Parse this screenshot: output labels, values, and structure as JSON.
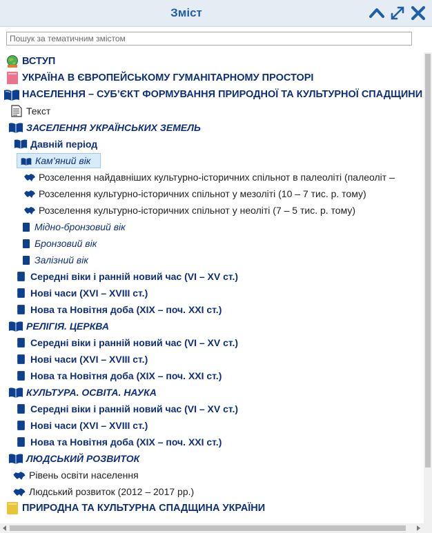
{
  "header": {
    "title": "Зміст",
    "icons": [
      "chevron-up-icon",
      "expand-icon",
      "close-icon"
    ],
    "accent": "#1f5fa8"
  },
  "search": {
    "placeholder": "Пошук за тематичним змістом",
    "value": ""
  },
  "tree": {
    "r0": "ВСТУП",
    "r1": "УКРАЇНА В ЄВРОПЕЙСЬКОМУ ГУМАНІТАРНОМУ ПРОСТОРІ",
    "r2": "НАСЕЛЕННЯ – СУБ’ЄКТ ФОРМУВАННЯ ПРИРОДНОЇ ТА КУЛЬТУРНОЇ СПАДЩИНИ",
    "r3": "Текст",
    "r4": "ЗАСЕЛЕННЯ УКРАЇНСЬКИХ ЗЕМЕЛЬ",
    "r5": "Давній період",
    "r6": "Кам’яний вік",
    "r7": "Розселення найдавніших культурно-історичних спільнот в палеоліті (палеоліт –",
    "r8": "Розселення культурно-історичних спільнот у мезоліті (10 – 7 тис. р. тому)",
    "r9": "Розселення культурно-історичних спільнот у неоліті (7 – 5 тис. р. тому)",
    "r10": "Мідно-бронзовий вік",
    "r11": "Бронзовий вік",
    "r12": "Залізний вік",
    "r13": "Середні віки і ранній новий час (VI – XV ст.)",
    "r14": "Нові часи (XVI – XVIII ст.)",
    "r15": "Нова та Новітня доба (XIX – поч. XXI ст.)",
    "r16": "РЕЛІГІЯ. ЦЕРКВА",
    "r17": "Середні віки і ранній новий час (VI – XV ст.)",
    "r18": "Нові часи (XVI – XVIII ст.)",
    "r19": "Нова та Новітня доба (XIX – поч. XXI ст.)",
    "r20": "КУЛЬТУРА. ОСВІТА. НАУКА",
    "r21": "Середні віки і ранній новий час (VI – XV ст.)",
    "r22": "Нові часи (XVI – XVIII ст.)",
    "r23": "Нова та Новітня доба (XIX – поч. XXI ст.)",
    "r24": "ЛЮДСЬКИЙ РОЗВИТОК",
    "r25": "Рівень освіти населення",
    "r26": "Людський розвиток (2012 – 2017 рр.)",
    "r27": "ПРИРОДНА ТА КУЛЬТУРНА СПАДЩИНА УКРАЇНИ",
    "selected": "Кам’яний вік",
    "icon_names": [
      "globe-book-icon",
      "pink-book-icon",
      "open-book-icon",
      "document-icon",
      "open-book-icon",
      "ukraine-map-icon",
      "yellow-book-icon"
    ],
    "colors": {
      "book_blue": "#0d3f8f",
      "selected_bg": "#d7ebf8",
      "pink": "#e8748e",
      "yellow": "#e8c43a"
    }
  }
}
